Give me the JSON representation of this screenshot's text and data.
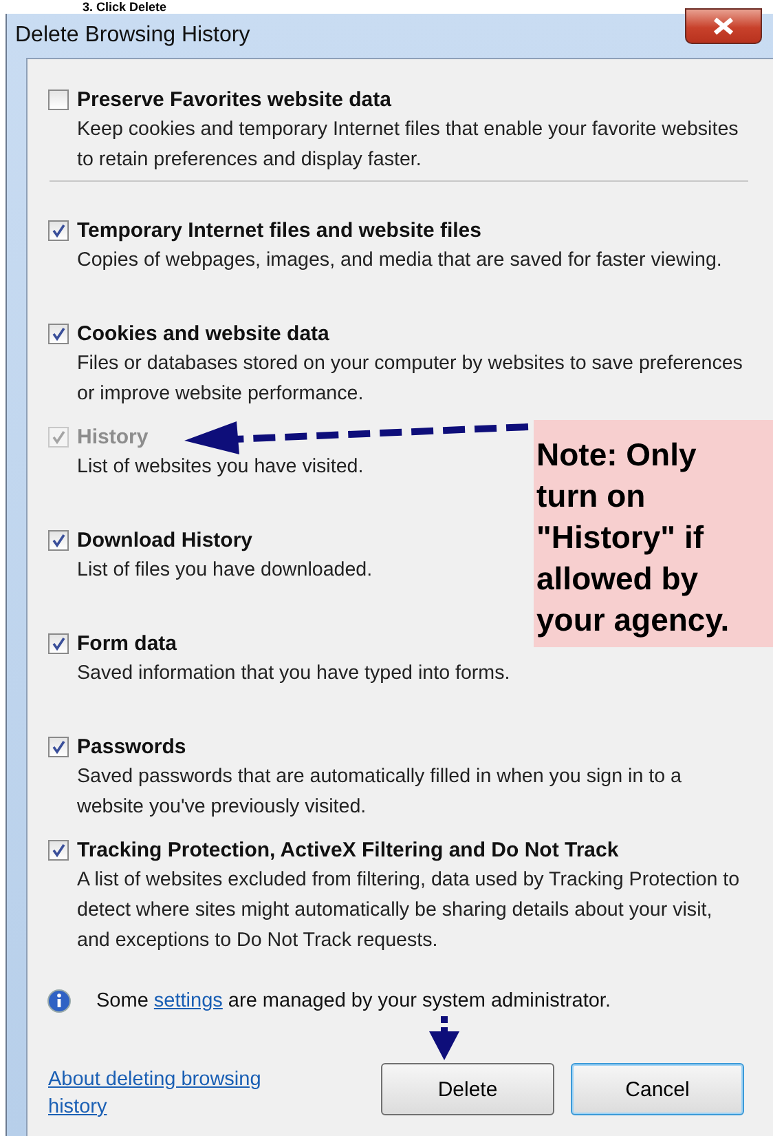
{
  "step_heading": "3.  Click Delete",
  "window": {
    "title": "Delete Browsing History"
  },
  "options": [
    {
      "title": "Preserve Favorites website data",
      "description": "Keep cookies and temporary Internet files that enable your favorite websites to retain preferences and display faster.",
      "checked": false,
      "disabled": false,
      "divider_after": true
    },
    {
      "title": "Temporary Internet files and website files",
      "description": "Copies of webpages, images, and media that are saved for faster viewing.",
      "checked": true,
      "disabled": false,
      "divider_after": false
    },
    {
      "title": "Cookies and website data",
      "description": "Files or databases stored on your computer by websites to save preferences or improve website performance.",
      "checked": true,
      "disabled": false,
      "divider_after": false
    },
    {
      "title": "History",
      "description": "List of websites you have visited.",
      "checked": true,
      "disabled": true,
      "divider_after": false
    },
    {
      "title": "Download History",
      "description": "List of files you have downloaded.",
      "checked": true,
      "disabled": false,
      "divider_after": false
    },
    {
      "title": "Form data",
      "description": "Saved information that you have typed into forms.",
      "checked": true,
      "disabled": false,
      "divider_after": false
    },
    {
      "title": "Passwords",
      "description": "Saved passwords that are automatically filled in when you sign in to a website you've previously visited.",
      "checked": true,
      "disabled": false,
      "divider_after": false
    },
    {
      "title": "Tracking Protection, ActiveX Filtering and Do Not Track",
      "description": "A list of websites excluded from filtering, data used by Tracking Protection to detect where sites might automatically be sharing details about your visit, and exceptions to Do Not Track requests.",
      "checked": true,
      "disabled": false,
      "divider_after": false
    }
  ],
  "admin_notice": {
    "before": "Some",
    "link": "settings",
    "after": "are managed by your system administrator."
  },
  "help_link": "About deleting browsing history",
  "buttons": [
    {
      "label": "Delete",
      "focused": false
    },
    {
      "label": "Cancel",
      "focused": true
    }
  ],
  "annotation": {
    "note": "Note: Only turn on \"History\" if allowed by your agency."
  }
}
